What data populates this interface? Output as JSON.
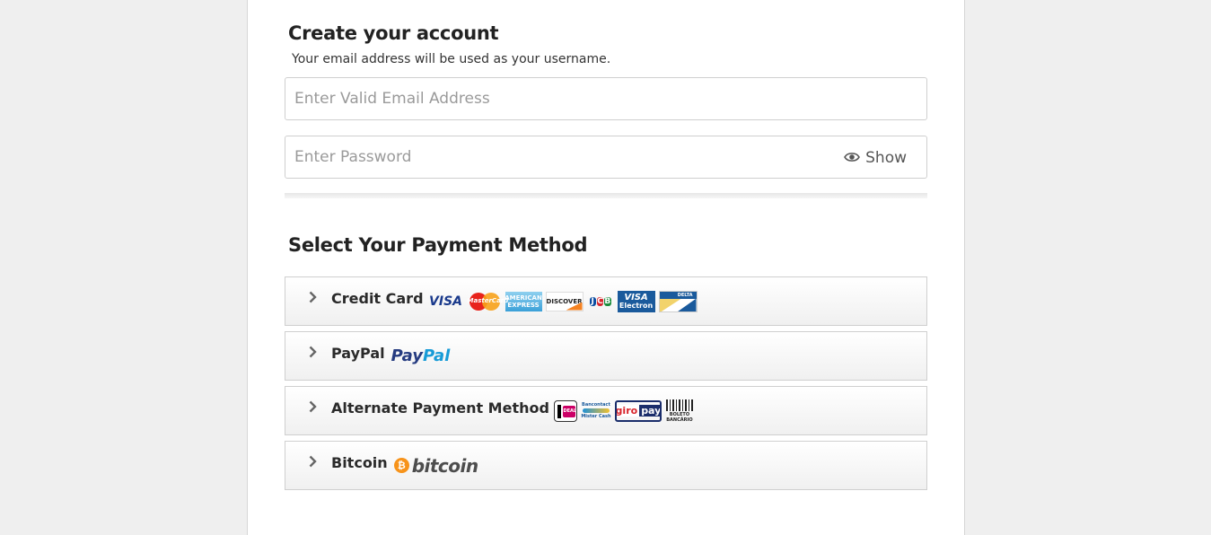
{
  "account": {
    "title": "Create your account",
    "subtitle": "Your email address will be used as your username.",
    "email_placeholder": "Enter Valid Email Address",
    "password_placeholder": "Enter Password",
    "show_label": "Show"
  },
  "payment": {
    "title": "Select Your Payment Method",
    "methods": [
      {
        "label": "Credit Card",
        "logos": [
          "VISA",
          "MasterCard",
          "AMERICAN EXPRESS",
          "DISCOVER",
          "JCB",
          "VISA Electron",
          "DELTA"
        ]
      },
      {
        "label": "PayPal",
        "logos": [
          "PayPal"
        ]
      },
      {
        "label": "Alternate Payment Method",
        "logos": [
          "iDEAL",
          "Bancontact Mister Cash",
          "giropay",
          "BOLETO BANCÁRIO"
        ]
      },
      {
        "label": "Bitcoin",
        "logos": [
          "bitcoin"
        ]
      }
    ]
  },
  "logo_text": {
    "visa": "VISA",
    "mastercard": "MasterCard",
    "amex_1": "AMERICAN",
    "amex_2": "EXPRESS",
    "discover": "DISCOVER",
    "jcb_j": "J",
    "jcb_c": "C",
    "jcb_b": "B",
    "visa_electron_1": "VISA",
    "visa_electron_2": "Electron",
    "delta": "DELTA",
    "paypal_1": "Pay",
    "paypal_2": "Pal",
    "ideal": "iDEAL",
    "bancontact_1": "Bancontact",
    "bancontact_2": "Mister Cash",
    "giro_1": "giro",
    "giro_2": "pay",
    "boleto_1": "BOLETO",
    "boleto_2": "BANCÁRIO",
    "bitcoin_symbol": "₿",
    "bitcoin": "bitcoin"
  },
  "colors": {
    "page_bg": "#efefef",
    "panel_bg": "#ffffff",
    "paypal_blue": "#253b80",
    "paypal_light": "#179bd7",
    "bitcoin_orange": "#f7931a"
  },
  "icons": {
    "show": "eye-icon",
    "expand": "chevron-right-icon"
  }
}
